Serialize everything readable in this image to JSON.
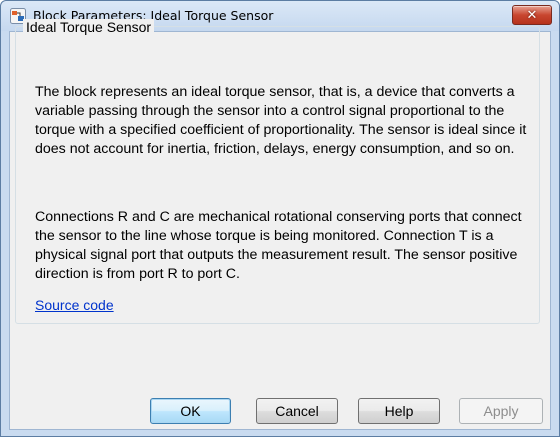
{
  "window": {
    "title": "Block Parameters: Ideal Torque Sensor",
    "close_glyph": "✕",
    "icon": "simulink-block-icon"
  },
  "group": {
    "legend": "Ideal Torque Sensor",
    "description_1": "The block represents an ideal torque sensor, that is, a device that converts a variable passing through the sensor into a control signal proportional to the torque with a specified coefficient of proportionality. The sensor is ideal since it does not account for inertia, friction, delays, energy consumption, and so on.",
    "description_2": "Connections R and C are mechanical rotational conserving ports that connect the sensor to the line whose torque is being monitored. Connection T is a physical signal port that outputs the measurement result. The sensor positive direction is from port R to port C.",
    "source_link": "Source code"
  },
  "buttons": {
    "ok": "OK",
    "cancel": "Cancel",
    "help": "Help",
    "apply": "Apply"
  },
  "colors": {
    "link": "#0033cc",
    "close_red": "#c8462f",
    "frame": "#c9dbf0",
    "disabled_text": "#8d8d8d"
  }
}
